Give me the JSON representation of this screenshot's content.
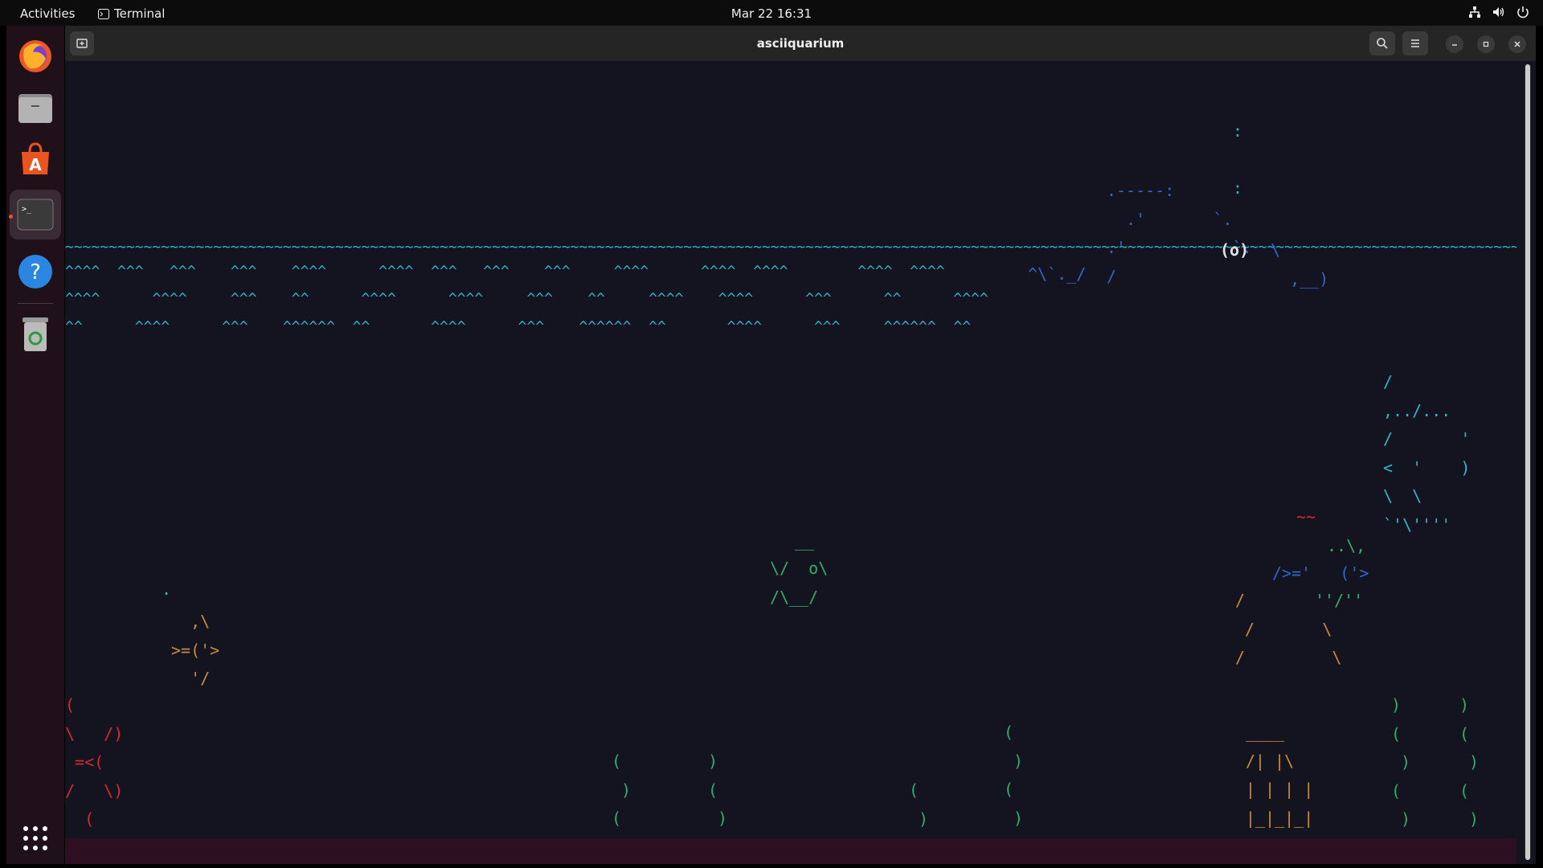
{
  "topbar": {
    "activities_label": "Activities",
    "app_label": "Terminal",
    "clock": "Mar 22  16:31",
    "tray_icons": [
      "network-icon",
      "volume-icon",
      "power-icon"
    ]
  },
  "dock": {
    "items": [
      "firefox-icon",
      "files-icon",
      "app-center-icon",
      "terminal-icon",
      "help-icon",
      "trash-icon",
      "show-apps-icon"
    ],
    "active_item": "terminal-icon"
  },
  "window": {
    "title": "asciiquarium",
    "buttons": [
      "new-tab-icon",
      "search-icon",
      "menu-icon",
      "minimize-icon",
      "maximize-icon",
      "close-icon"
    ]
  },
  "colors": {
    "water": "#2fb5c8",
    "green": "#2fae6a",
    "red": "#d62a2a",
    "orange": "#c98a3a",
    "blue": "#2f66c8",
    "magenta": "#c02fc0",
    "white": "#e0e0e0",
    "terminal_bg": "#141420",
    "ubuntu_orange": "#e95420"
  },
  "scene": {
    "water1": "~~~~~~~~~~~~~~~~~~~~~~~~~~~~~~~~~~~~~~~~~~~~~~~~~~~~~~~~~~~~~~~~~~~~~~~~~~~~~~~~~~~~~~~~~~~~~~~~~~~~~~~~~~~~~~~~~~~~~~~~~~~~~~~~~~~~~~~~~~~~~~~~~~~~~~~~~~~~~~~~~~~~~~~~~~~~~~~~~~~~~~~~~~~~~~~~~~~~~~~~~~~~~~~~~~~~",
    "water2": "^^^^  ^^^   ^^^    ^^^    ^^^^      ^^^^  ^^^   ^^^    ^^^     ^^^^      ^^^^  ^^^^        ^^^^  ^^^^",
    "water3": "^^^^      ^^^^     ^^^    ^^      ^^^^      ^^^^     ^^^    ^^     ^^^^    ^^^^      ^^^      ^^      ^^^^",
    "water4": "^^      ^^^^      ^^^    ^^^^^^  ^^       ^^^^      ^^^    ^^^^^^  ^^       ^^^^      ^^^     ^^^^^^  ^^",
    "whale_spout": ":\n\n:",
    "whale_left": ".-----:\n  .'       `.\n.'           `.\n/",
    "whale_right": "\\\n  ,__)",
    "whale_eye": "(o)",
    "whale_tail": "^\\`._/",
    "small_fish_dot": ".",
    "small_fish": "  ,\\\n>=('>\n  '/",
    "center_fish_top": "__",
    "center_fish_mid": "\\/  o\\",
    "center_fish_bot": "/\\__/",
    "right_fish": "/\n,../...\n/       '\n<  '    )\n\\  \\\n`'\\''''",
    "bubble": "~~",
    "shark_top": "..\\,",
    "shark_mid": "/>='   ('>",
    "shark_bot": "''/''",
    "shark_legs": "/\n /       \\\n/         \\",
    "crab": "(\n\\   /)\n =<(\n/   \\)\n  (\n   )",
    "castle": "____\n/| |\\\n| | | |\n|_|_|_|",
    "seaweed_a": "(\n )\n(\n )",
    "seaweed_b": ")\n(\n )\n(",
    "seaweed_c": "(\n )\n(\n )\n(",
    "seaweed_d": ")\n(\n )\n(\n )\n(",
    "seaweed_e": ")\n(\n )\n(\n )\n("
  }
}
